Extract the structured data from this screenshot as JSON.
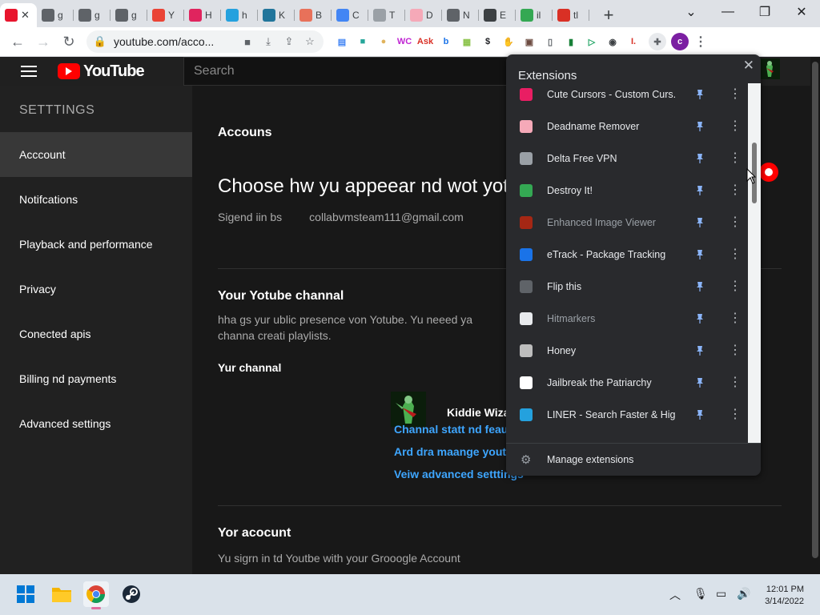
{
  "browser": {
    "tabs": [
      {
        "label": "",
        "fav": "recording-icon",
        "color": "#e8152d",
        "active": true
      },
      {
        "label": "g",
        "fav": "globe-icon",
        "color": "#5f6368"
      },
      {
        "label": "g",
        "fav": "globe-icon",
        "color": "#5f6368"
      },
      {
        "label": "g",
        "fav": "globe-icon",
        "color": "#5f6368"
      },
      {
        "label": "Y",
        "fav": "gmail-icon",
        "color": "#ea4335"
      },
      {
        "label": "H",
        "fav": "extension-icon",
        "color": "#e0245e"
      },
      {
        "label": "h",
        "fav": "liner-icon",
        "color": "#24a1de"
      },
      {
        "label": "K",
        "fav": "wordpress-icon",
        "color": "#21759b"
      },
      {
        "label": "B",
        "fav": "tab-icon",
        "color": "#e8715a"
      },
      {
        "label": "C",
        "fav": "google-icon",
        "color": "#4285f4"
      },
      {
        "label": "T",
        "fav": "r-icon",
        "color": "#9aa0a6"
      },
      {
        "label": "D",
        "fav": "flag-icon",
        "color": "#f5a9b8"
      },
      {
        "label": "N",
        "fav": "doc-icon",
        "color": "#5f6368"
      },
      {
        "label": "E",
        "fav": "puzzle-icon",
        "color": "#3c4043"
      },
      {
        "label": "il",
        "fav": "message-icon",
        "color": "#34a853"
      },
      {
        "label": "tl",
        "fav": "ask-icon",
        "color": "#d93025"
      }
    ],
    "url": "youtube.com/acco...",
    "ext_icons": [
      {
        "name": "ext-bookmark-icon",
        "color": "#4285f4",
        "glyph": "▤"
      },
      {
        "name": "ext-square-icon",
        "color": "#26a69a",
        "glyph": "■"
      },
      {
        "name": "ext-doge-icon",
        "color": "#e0b35c",
        "glyph": "●"
      },
      {
        "name": "ext-wc-icon",
        "color": "#c026d3",
        "glyph": "WC"
      },
      {
        "name": "ext-ask-icon",
        "color": "#d93025",
        "glyph": "Ask"
      },
      {
        "name": "ext-b-icon",
        "color": "#1a73e8",
        "glyph": "b"
      },
      {
        "name": "ext-pattern-icon",
        "color": "#8bc34a",
        "glyph": "▦"
      },
      {
        "name": "ext-dollar-icon",
        "color": "#202124",
        "glyph": "$"
      },
      {
        "name": "ext-hand-icon",
        "color": "#fbbc04",
        "glyph": "✋"
      },
      {
        "name": "ext-box-icon",
        "color": "#6d4c41",
        "glyph": "▣"
      },
      {
        "name": "ext-note-icon",
        "color": "#5f6368",
        "glyph": "▯"
      },
      {
        "name": "ext-green-icon",
        "color": "#188038",
        "glyph": "▮"
      },
      {
        "name": "ext-play-icon",
        "color": "#1aa260",
        "glyph": "▷"
      },
      {
        "name": "ext-lens-icon",
        "color": "#3c4043",
        "glyph": "◉"
      },
      {
        "name": "ext-i-icon",
        "color": "#d93025",
        "glyph": "I."
      }
    ],
    "profile_initial": "c"
  },
  "youtube": {
    "logo_text": "YouTube",
    "search_placeholder": "Search",
    "sidebar_title": "SETTTINGS",
    "sidebar_items": [
      "Acccount",
      "Notifcations",
      "Playback and performance",
      "Privacy",
      "Conected apis",
      "Billing nd payments",
      "Advanced settings"
    ],
    "main": {
      "heading": "Accouns",
      "title": "Choose hw yu appeear nd wot yot",
      "signed_label": "Sigend iin bs",
      "email": "collabvmsteam111@gmail.com",
      "channel_heading": "Your Yotube channal",
      "channel_desc": "hha gs yur ublic presence von Yotube. Yu neeed ya channa creati playlists.",
      "channel_label": "Yur channal",
      "channel_name": "Kiddie Wiza",
      "links": [
        "Channal statt nd feaut",
        "Ard dra maange yout c",
        "Veiw advanced setttings"
      ],
      "account_heading": "Yor acocunt",
      "account_desc": "Yu sigrn in td Youtbe with your Grooogle Account"
    }
  },
  "extensions_popup": {
    "title": "Extensions",
    "items": [
      {
        "name": "Cute Cursors - Custom Curs...",
        "icon": "cursor-icon",
        "color": "#e91e63",
        "dim": false
      },
      {
        "name": "Deadname Remover",
        "icon": "flag-icon",
        "color": "#f5a9b8",
        "dim": false
      },
      {
        "name": "Delta Free VPN",
        "icon": "delta-icon",
        "color": "#9aa0a6",
        "dim": false
      },
      {
        "name": "Destroy It!",
        "icon": "chrome-icon",
        "color": "#34a853",
        "dim": false
      },
      {
        "name": "Enhanced Image Viewer",
        "icon": "image-icon",
        "color": "#a52714",
        "dim": true
      },
      {
        "name": "eTrack - Package Tracking",
        "icon": "etrack-icon",
        "color": "#1a73e8",
        "dim": false
      },
      {
        "name": "Flip this",
        "icon": "flip-icon",
        "color": "#5f6368",
        "dim": false
      },
      {
        "name": "Hitmarkers",
        "icon": "hitmarker-icon",
        "color": "#e8eaed",
        "dim": true
      },
      {
        "name": "Honey",
        "icon": "honey-icon",
        "color": "#bdbdbd",
        "dim": false
      },
      {
        "name": "Jailbreak the Patriarchy",
        "icon": "jailbreak-icon",
        "color": "#ffffff",
        "dim": false
      },
      {
        "name": "LINER - Search Faster & Hig...",
        "icon": "liner-icon",
        "color": "#24a1de",
        "dim": false
      }
    ],
    "manage_label": "Manage extensions"
  },
  "taskbar": {
    "time": "12:01 PM",
    "date": "3/14/2022"
  }
}
